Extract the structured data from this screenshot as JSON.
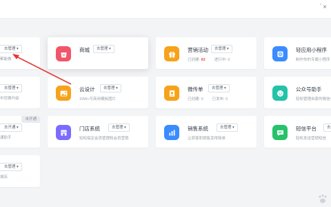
{
  "window": {
    "close_icon": "×"
  },
  "colors": {
    "red": "#f0566a",
    "orange": "#f7a21b",
    "blue": "#3a8cff",
    "teal": "#24c3a8",
    "purple": "#7c6bff",
    "green": "#27c26a",
    "accent": "#ef5350"
  },
  "left_column": [
    {
      "manage_label": "去管理 ▾",
      "desc": "都能做"
    },
    {
      "manage_label": "去管理 ▾",
      "desc": "中优雅升级"
    },
    {
      "manage_label": "去开通 ▾",
      "desc": "通助手",
      "badge": "未开通"
    },
    {
      "manage_label": "去管理 ▾",
      "desc": "城店"
    }
  ],
  "cards": {
    "mall": {
      "title": "商城",
      "manage_label": "去管理 ▾",
      "icon": "shop-bag-icon"
    },
    "marketing": {
      "title": "营销活动",
      "manage_label": "去管理 ▾",
      "created_label": "已创建:",
      "created_value": "83",
      "running_label": "进行中:",
      "running_value": "0",
      "icon": "gift-icon"
    },
    "miniapp": {
      "title": "轻应用小程序",
      "manage_label": "去管理 ▾",
      "desc": "制作你的专属小程序",
      "icon": "miniapp-icon"
    },
    "cloud_design": {
      "title": "云设计",
      "manage_label": "去管理 ▾",
      "desc": "10W+可商用模板图片",
      "icon": "image-icon"
    },
    "weidan": {
      "title": "微传单",
      "manage_label": "去管理 ▾",
      "created_label": "已创建:",
      "created_value": "0",
      "published_label": "已发布:",
      "published_value": "0",
      "icon": "leaflet-icon"
    },
    "official_assistant": {
      "title": "公众号助手",
      "manage_label": "去管理 ▾",
      "desc": "轻松管理自家的微信公众号",
      "icon": "assistant-icon"
    },
    "store_system": {
      "title": "门店系统",
      "manage_label": "去管理 ▾",
      "desc": "轻松搞定会员管理和会员营销",
      "icon": "store-icon"
    },
    "sales_system": {
      "title": "销售系统",
      "manage_label": "去管理 ▾",
      "desc": "让获客和销售变得简单",
      "icon": "bar-chart-icon"
    },
    "sms_platform": {
      "title": "短信平台",
      "manage_label": "去管理 ▾",
      "desc": "轻松发送营销短信",
      "icon": "sms-icon"
    }
  }
}
